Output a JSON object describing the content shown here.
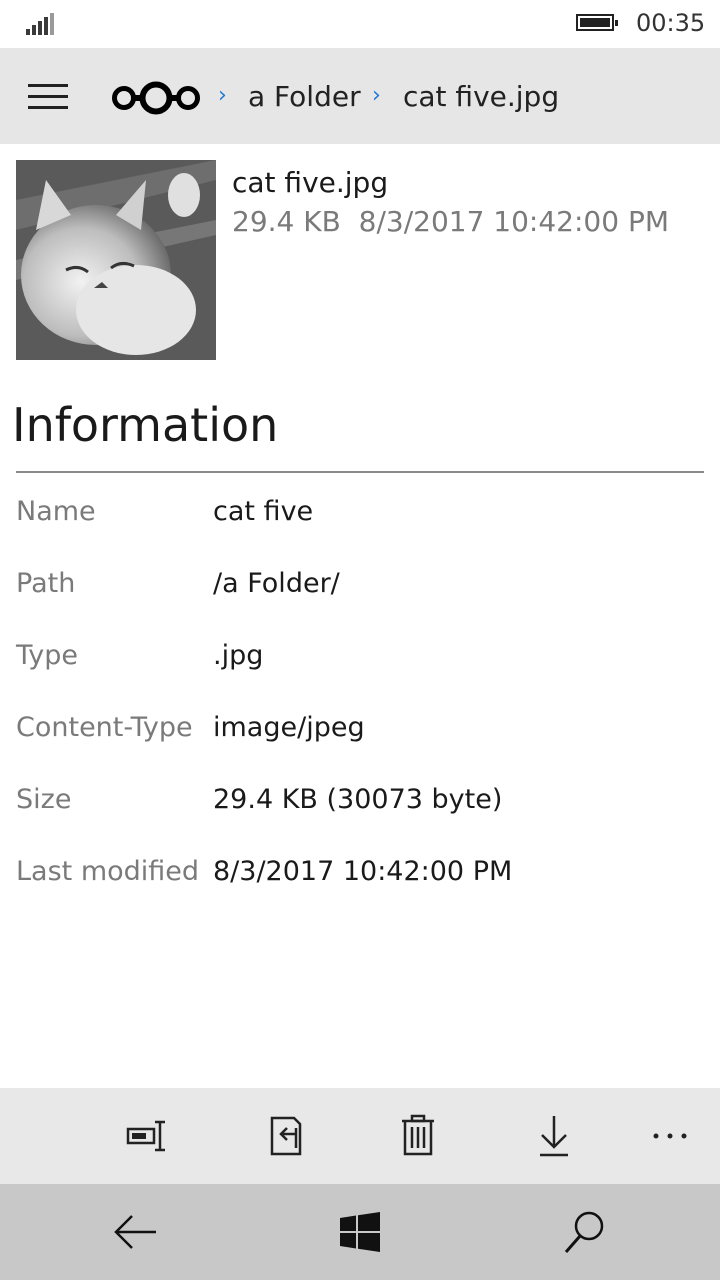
{
  "status": {
    "time": "00:35"
  },
  "header": {
    "breadcrumb": [
      {
        "label": "a Folder"
      },
      {
        "label": "cat five.jpg"
      }
    ]
  },
  "file": {
    "name": "cat five.jpg",
    "size": "29.4 KB",
    "modified": "8/3/2017 10:42:00 PM"
  },
  "info": {
    "title": "Information",
    "rows": [
      {
        "label": "Name",
        "value": "cat five"
      },
      {
        "label": "Path",
        "value": "/a Folder/"
      },
      {
        "label": "Type",
        "value": ".jpg"
      },
      {
        "label": "Content-Type",
        "value": "image/jpeg"
      },
      {
        "label": "Size",
        "value": "29.4 KB (30073 byte)"
      },
      {
        "label": "Last modified",
        "value": "8/3/2017 10:42:00 PM"
      }
    ]
  },
  "commands": {
    "icons": [
      "rename-icon",
      "move-icon",
      "delete-icon",
      "download-icon",
      "more-icon"
    ],
    "more_label": "..."
  },
  "colors": {
    "accent": "#1e7ad6",
    "appbar_bg": "#e6e6e6",
    "navbar_bg": "#c8c8c8"
  }
}
